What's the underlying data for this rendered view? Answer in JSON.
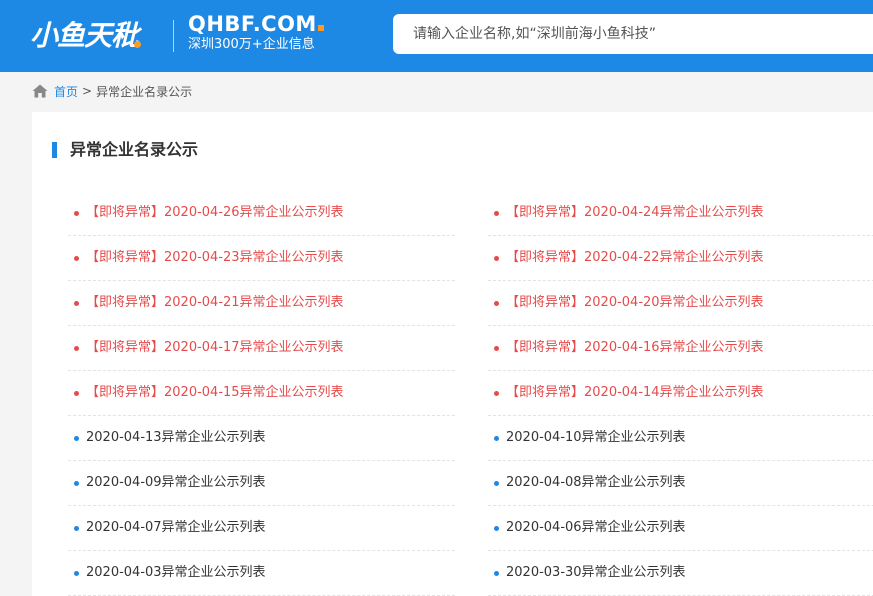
{
  "header": {
    "logo_cn": "小鱼天秕",
    "logo_en": "QHBF.COM",
    "slogan": "深圳300万+企业信息",
    "search_placeholder": "请输入企业名称,如“深圳前海小鱼科技”",
    "bg_color": "#1e88e5",
    "accent_color": "#ff9a1f"
  },
  "breadcrumb": {
    "home_icon": "home-icon",
    "home_label": "首页",
    "separator": ">",
    "current": "异常企业名录公示"
  },
  "panel": {
    "title": "异常企业名录公示",
    "items": [
      {
        "label": "【即将异常】2020-04-26异常企业公示列表",
        "status": "warn"
      },
      {
        "label": "【即将异常】2020-04-24异常企业公示列表",
        "status": "warn"
      },
      {
        "label": "【即将异常】2020-04-23异常企业公示列表",
        "status": "warn"
      },
      {
        "label": "【即将异常】2020-04-22异常企业公示列表",
        "status": "warn"
      },
      {
        "label": "【即将异常】2020-04-21异常企业公示列表",
        "status": "warn"
      },
      {
        "label": "【即将异常】2020-04-20异常企业公示列表",
        "status": "warn"
      },
      {
        "label": "【即将异常】2020-04-17异常企业公示列表",
        "status": "warn"
      },
      {
        "label": "【即将异常】2020-04-16异常企业公示列表",
        "status": "warn"
      },
      {
        "label": "【即将异常】2020-04-15异常企业公示列表",
        "status": "warn"
      },
      {
        "label": "【即将异常】2020-04-14异常企业公示列表",
        "status": "warn"
      },
      {
        "label": "2020-04-13异常企业公示列表",
        "status": "norm"
      },
      {
        "label": "2020-04-10异常企业公示列表",
        "status": "norm"
      },
      {
        "label": "2020-04-09异常企业公示列表",
        "status": "norm"
      },
      {
        "label": "2020-04-08异常企业公示列表",
        "status": "norm"
      },
      {
        "label": "2020-04-07异常企业公示列表",
        "status": "norm"
      },
      {
        "label": "2020-04-06异常企业公示列表",
        "status": "norm"
      },
      {
        "label": "2020-04-03异常企业公示列表",
        "status": "norm"
      },
      {
        "label": "2020-03-30异常企业公示列表",
        "status": "norm"
      }
    ],
    "warn_color": "#e54b4b",
    "normal_color": "#333333",
    "bullet_blue": "#1e88e5"
  }
}
